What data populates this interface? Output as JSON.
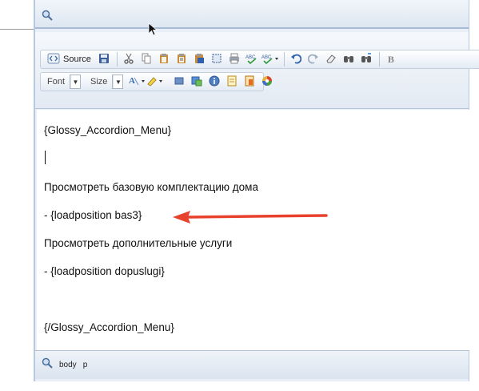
{
  "toolbar": {
    "source_label": "Source",
    "font_label": "Font",
    "size_label": "Size",
    "bold_label": "B"
  },
  "content": {
    "lines": [
      "{Glossy_Accordion_Menu}",
      "Просмотреть базовую комплектацию дома",
      "- {loadposition bas3}",
      "Просмотреть дополнительные услуги",
      "- {loadposition dopuslugi}",
      "{/Glossy_Accordion_Menu}"
    ]
  },
  "statusbar": {
    "path": [
      "body",
      "p"
    ]
  },
  "colors": {
    "annotation_arrow": "#e8412c",
    "chrome": "#dde6f1"
  }
}
